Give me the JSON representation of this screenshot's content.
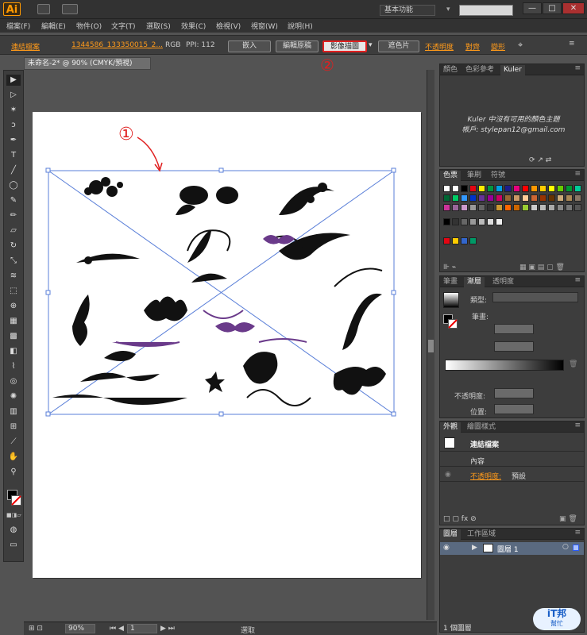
{
  "app": {
    "logo": "Ai",
    "workspace": "基本功能"
  },
  "window": {
    "min": "—",
    "max": "□",
    "close": "✕"
  },
  "menu": [
    "檔案(F)",
    "編輯(E)",
    "物件(O)",
    "文字(T)",
    "選取(S)",
    "效果(C)",
    "檢視(V)",
    "視窗(W)",
    "說明(H)"
  ],
  "control": {
    "link_label": "連結檔案",
    "file_name": "1344586_133350015_2...",
    "color_mode": "RGB",
    "ppi": "PPI: 112",
    "embed": "嵌入",
    "edit_original": "編輯原稿",
    "image_trace": "影像描圖",
    "mask": "遮色片",
    "opacity": "不透明度",
    "align": "對齊",
    "transform": "變形"
  },
  "document": {
    "tab": "未命名-2* @ 90% (CMYK/預視)"
  },
  "annotations": {
    "one": "①",
    "two": "②"
  },
  "status": {
    "zoom": "90%",
    "page": "1",
    "tool": "選取"
  },
  "kuler": {
    "tabs": [
      "顏色",
      "色彩參考",
      "Kuler"
    ],
    "message": "Kuler 中沒有可用的顏色主題",
    "account": "帳戶: stylepan12@gmail.com"
  },
  "swatches": {
    "tabs": [
      "色票",
      "筆刷",
      "符號"
    ]
  },
  "stroke": {
    "tabs": [
      "筆畫",
      "漸層",
      "透明度"
    ],
    "type_label": "類型:",
    "stroke_label": "筆畫:",
    "opacity_label": "不透明度:",
    "position_label": "位置:"
  },
  "appearance": {
    "tabs": [
      "外觀",
      "繪圖樣式"
    ],
    "title": "連結檔案",
    "content": "內容",
    "opacity": "不透明度:",
    "opacity_value": "預設"
  },
  "layers": {
    "tabs": [
      "圖層",
      "工作區域"
    ],
    "layer1": "圖層 1",
    "count": "1 個圖層"
  },
  "watermark": {
    "line1": "iT邦",
    "line2": "幫忙"
  }
}
